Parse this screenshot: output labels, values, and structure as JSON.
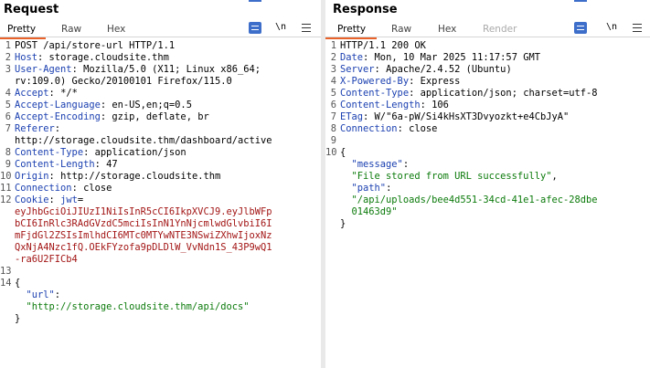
{
  "request": {
    "title": "Request",
    "tabs": [
      {
        "label": "Pretty",
        "active": true
      },
      {
        "label": "Raw",
        "active": false
      },
      {
        "label": "Hex",
        "active": false
      }
    ],
    "wrap_label": "\\n",
    "request_line": "POST /api/store-url HTTP/1.1",
    "headers": [
      {
        "key": "Host",
        "value": " storage.cloudsite.thm"
      },
      {
        "key": "User-Agent",
        "value": " Mozilla/5.0 (X11; Linux x86_64;",
        "cont": [
          "rv:109.0) Gecko/20100101 Firefox/115.0"
        ]
      },
      {
        "key": "Accept",
        "value": " */*"
      },
      {
        "key": "Accept-Language",
        "value": " en-US,en;q=0.5"
      },
      {
        "key": "Accept-Encoding",
        "value": " gzip, deflate, br"
      },
      {
        "key": "Referer",
        "value": "",
        "cont": [
          "http://storage.cloudsite.thm/dashboard/active"
        ]
      },
      {
        "key": "Content-Type",
        "value": " application/json"
      },
      {
        "key": "Content-Length",
        "value": " 47"
      },
      {
        "key": "Origin",
        "value": " http://storage.cloudsite.thm"
      },
      {
        "key": "Connection",
        "value": " close"
      }
    ],
    "cookie": {
      "key": "Cookie",
      "name": "jwt",
      "lines": [
        "eyJhbGciOiJIUzI1NiIsInR5cCI6IkpXVCJ9.eyJlbWFp",
        "bCI6InRlc3RAdGVzdC5mciIsInN1YnNjcmlwdGlvbiI6I",
        "mFjdGl2ZSIsImlhdCI6MTc0MTYwNTE3NSwiZXhwIjoxNz",
        "QxNjA4Nzc1fQ.OEkFYzofa9pDLDlW_VvNdn1S_43P9wQ1",
        "-ra6U2FICb4"
      ]
    },
    "body": {
      "open": "{",
      "key": "\"url\"",
      "colon": ":",
      "value": "\"http://storage.cloudsite.thm/api/docs\"",
      "close": "}"
    },
    "line_numbers": [
      "1",
      "2",
      "3",
      "4",
      "5",
      "6",
      "7",
      "8",
      "9",
      "10",
      "11",
      "12",
      "13",
      "14",
      "15"
    ]
  },
  "response": {
    "title": "Response",
    "tabs": [
      {
        "label": "Pretty",
        "active": true
      },
      {
        "label": "Raw",
        "active": false
      },
      {
        "label": "Hex",
        "active": false
      },
      {
        "label": "Render",
        "active": false
      }
    ],
    "wrap_label": "\\n",
    "status_line": "HTTP/1.1 200 OK",
    "headers": [
      {
        "key": "Date",
        "value": " Mon, 10 Mar 2025 11:17:57 GMT"
      },
      {
        "key": "Server",
        "value": " Apache/2.4.52 (Ubuntu)"
      },
      {
        "key": "X-Powered-By",
        "value": " Express"
      },
      {
        "key": "Content-Type",
        "value": " application/json; charset=utf-8"
      },
      {
        "key": "Content-Length",
        "value": " 106"
      },
      {
        "key": "ETag",
        "value": " W/\"6a-pW/Si4kHsXT3Dvyozkt+e4CbJyA\""
      },
      {
        "key": "Connection",
        "value": " close"
      }
    ],
    "body": {
      "open": "{",
      "message_key": "\"message\"",
      "message_value": "\"File stored from URL successfully\"",
      "path_key": "\"path\"",
      "path_value_lines": [
        "\"/api/uploads/bee4d551-34cd-41e1-afec-28dbe",
        "01463d9\""
      ],
      "close": "}"
    },
    "line_numbers": [
      "1",
      "2",
      "3",
      "4",
      "5",
      "6",
      "7",
      "8",
      "9",
      "10"
    ]
  },
  "colors": {
    "header_key": "#1a3fb0",
    "string": "#0b7a0b",
    "cookie": "#a31515",
    "accent": "#e8622a",
    "button": "#3d6ec9"
  }
}
